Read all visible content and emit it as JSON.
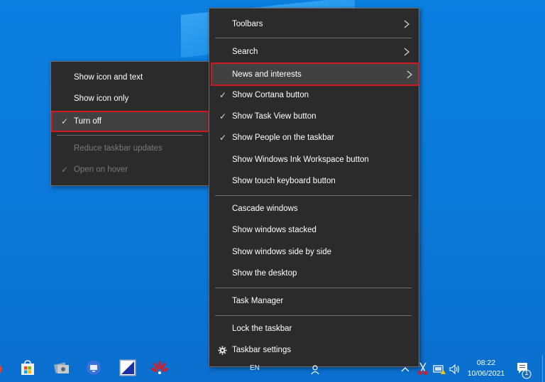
{
  "main_menu": {
    "items": [
      {
        "label": "Toolbars",
        "checked": false,
        "submenu": true
      },
      {
        "label": "Search",
        "checked": false,
        "submenu": true
      },
      {
        "label": "News and interests",
        "checked": false,
        "submenu": true,
        "highlighted": true
      },
      {
        "label": "Show Cortana button",
        "checked": true
      },
      {
        "label": "Show Task View button",
        "checked": true
      },
      {
        "label": "Show People on the taskbar",
        "checked": true
      },
      {
        "label": "Show Windows Ink Workspace button",
        "checked": false
      },
      {
        "label": "Show touch keyboard button",
        "checked": false
      },
      {
        "label": "Cascade windows",
        "checked": false
      },
      {
        "label": "Show windows stacked",
        "checked": false
      },
      {
        "label": "Show windows side by side",
        "checked": false
      },
      {
        "label": "Show the desktop",
        "checked": false
      },
      {
        "label": "Task Manager",
        "checked": false
      },
      {
        "label": "Lock the taskbar",
        "checked": false
      },
      {
        "label": "Taskbar settings",
        "icon": "gear-icon"
      }
    ]
  },
  "sub_menu": {
    "items": [
      {
        "label": "Show icon and text",
        "checked": false
      },
      {
        "label": "Show icon only",
        "checked": false
      },
      {
        "label": "Turn off",
        "checked": true,
        "highlighted": true
      },
      {
        "label": "Reduce taskbar updates",
        "checked": false,
        "disabled": true
      },
      {
        "label": "Open on hover",
        "checked": true,
        "disabled": true
      }
    ]
  },
  "check_glyph": "✓",
  "taskbar": {
    "language": "EN",
    "time": "08:22",
    "date": "10/06/2021",
    "notification_count": "1"
  },
  "colors": {
    "highlight_border": "#d0181f",
    "menu_bg": "#2b2b2b",
    "desktop_blue": "#0a7fe0"
  }
}
